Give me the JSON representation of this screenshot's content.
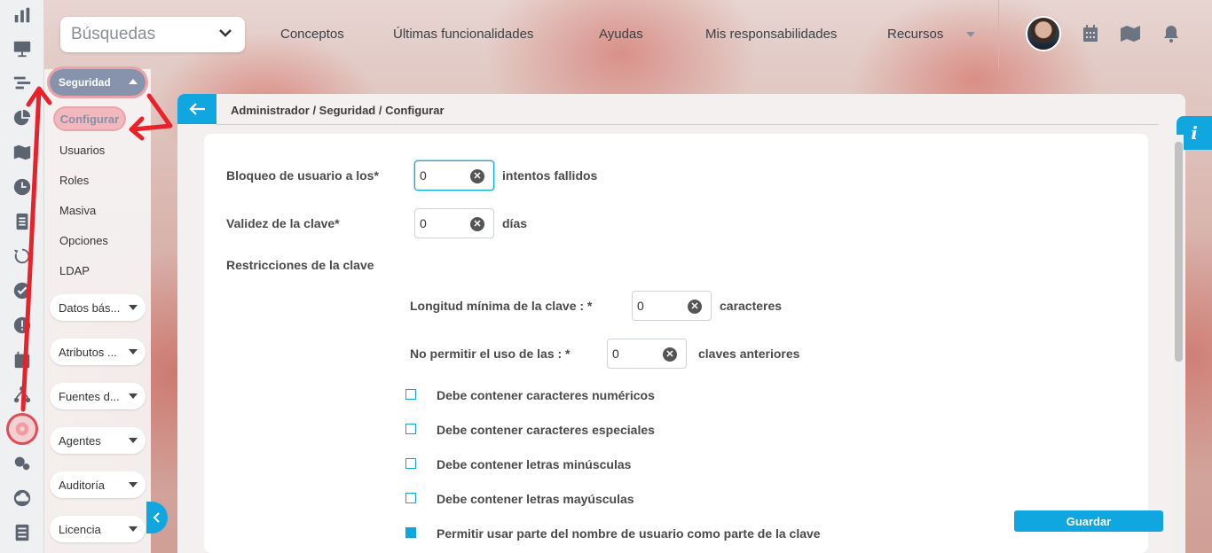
{
  "topbar": {
    "search_placeholder": "Búsquedas",
    "nav": [
      "Conceptos",
      "Últimas funcionalidades",
      "Ayudas",
      "Mis responsabilidades",
      "Recursos"
    ]
  },
  "submenu": {
    "section": "Seguridad",
    "active_item": "Configurar",
    "items": [
      "Usuarios",
      "Roles",
      "Masiva",
      "Opciones",
      "LDAP"
    ],
    "groups": [
      "Datos bás...",
      "Atributos ...",
      "Fuentes d...",
      "Agentes",
      "Auditoría",
      "Licencia"
    ]
  },
  "breadcrumb": "Administrador / Seguridad / Configurar",
  "info_label": "i",
  "form": {
    "lockout": {
      "label": "Bloqueo de usuario a los*",
      "value": "0",
      "suffix": "intentos fallidos"
    },
    "validity": {
      "label": "Validez de la clave*",
      "value": "0",
      "suffix": "días"
    },
    "restrictions_title": "Restricciones de la clave",
    "min_length": {
      "label": "Longitud mínima de la clave : *",
      "value": "0",
      "suffix": "caracteres"
    },
    "history": {
      "label": "No permitir el uso de las : *",
      "value": "0",
      "suffix": "claves anteriores"
    },
    "checks": [
      {
        "label": "Debe contener caracteres numéricos",
        "checked": false
      },
      {
        "label": "Debe contener caracteres especiales",
        "checked": false
      },
      {
        "label": "Debe contener letras minúsculas",
        "checked": false
      },
      {
        "label": "Debe contener letras mayúsculas",
        "checked": false
      },
      {
        "label": "Permitir usar parte del nombre de usuario como parte de la clave",
        "checked": true
      }
    ]
  },
  "save_label": "Guardar",
  "colors": {
    "accent": "#10a6e0",
    "annotation": "#e8212b"
  }
}
